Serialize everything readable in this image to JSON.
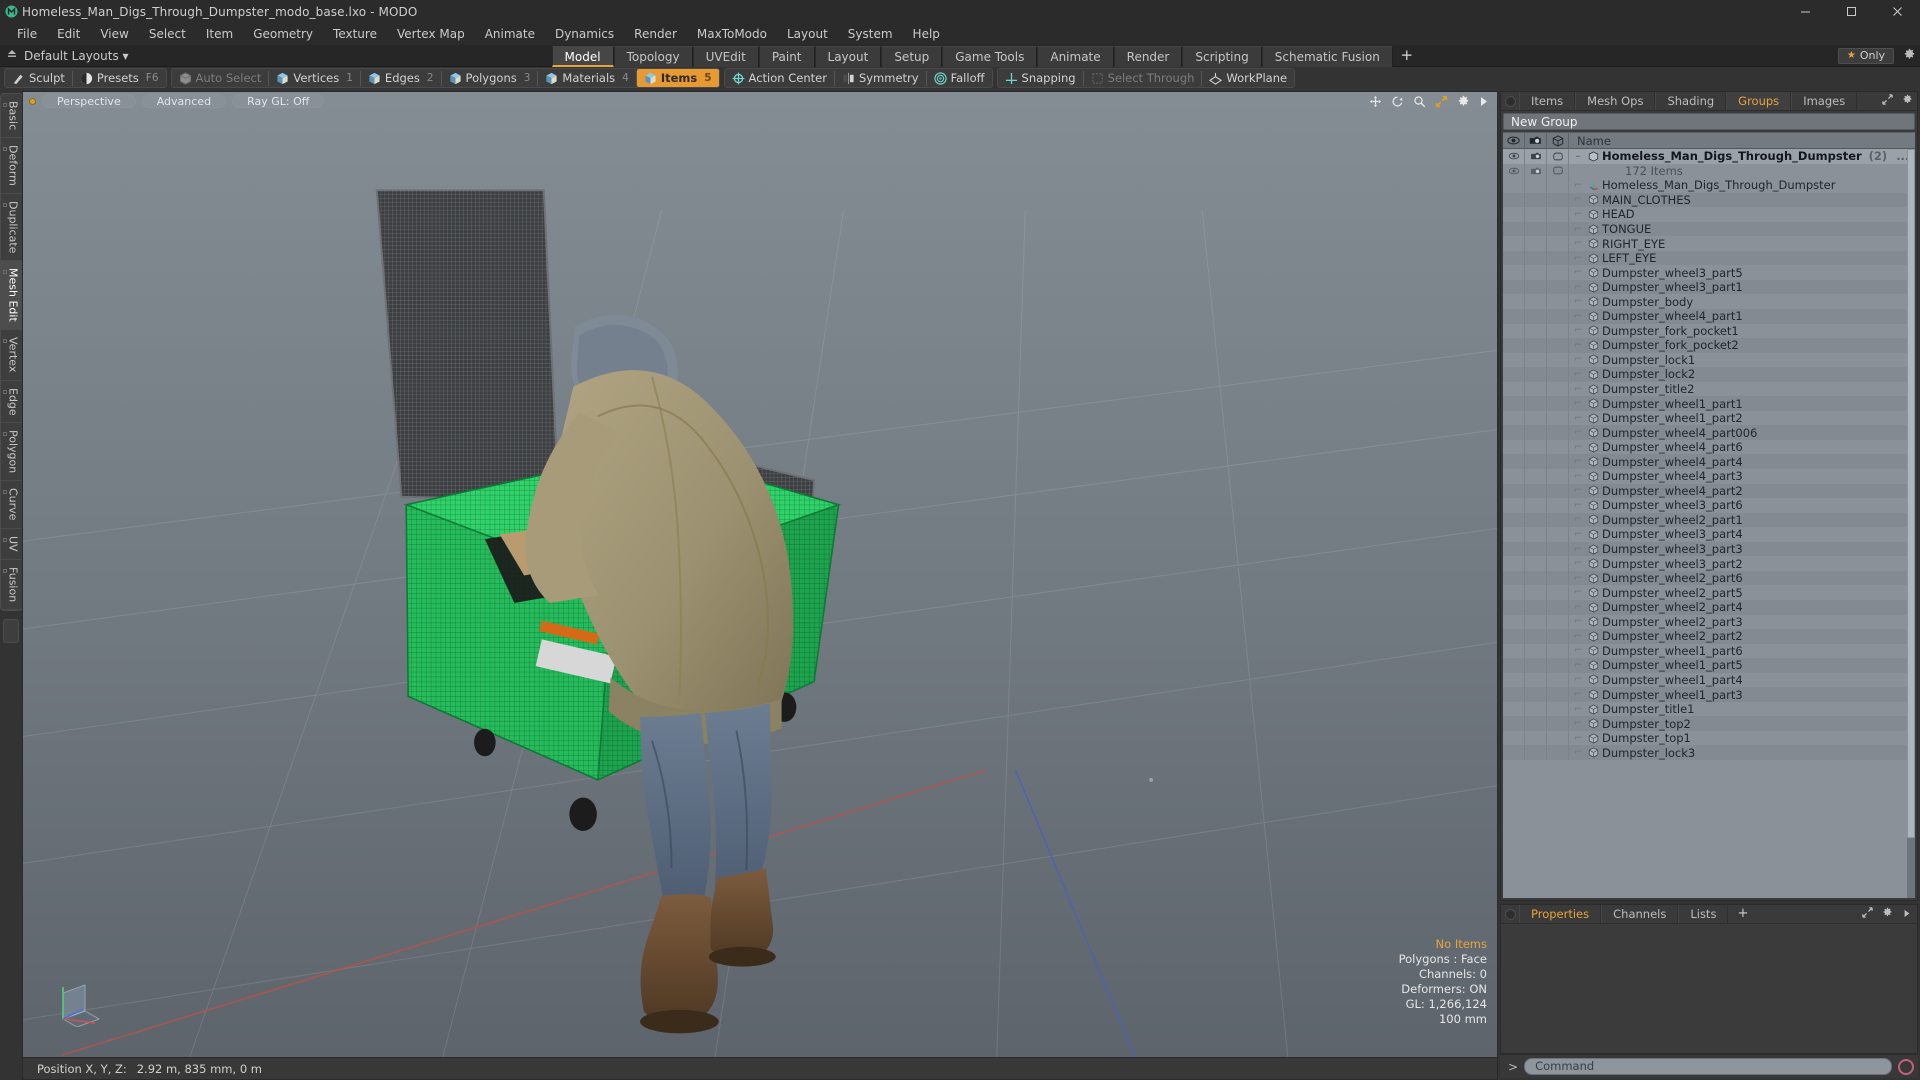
{
  "window": {
    "title": "Homeless_Man_Digs_Through_Dumpster_modo_base.lxo - MODO",
    "app_icon": "modo-logo-icon",
    "minimize": "–",
    "maximize": "□",
    "close": "✕"
  },
  "menubar": {
    "items": [
      "File",
      "Edit",
      "View",
      "Select",
      "Item",
      "Geometry",
      "Texture",
      "Vertex Map",
      "Animate",
      "Dynamics",
      "Render",
      "MaxToModo",
      "Layout",
      "System",
      "Help"
    ]
  },
  "layoutbar": {
    "home_icon": "home-arrow-icon",
    "default_layouts": "Default Layouts ▾",
    "tabs": [
      {
        "label": "Model",
        "active": true
      },
      {
        "label": "Topology",
        "active": false
      },
      {
        "label": "UVEdit",
        "active": false
      },
      {
        "label": "Paint",
        "active": false
      },
      {
        "label": "Layout",
        "active": false
      },
      {
        "label": "Setup",
        "active": false
      },
      {
        "label": "Game Tools",
        "active": false
      },
      {
        "label": "Animate",
        "active": false
      },
      {
        "label": "Render",
        "active": false
      },
      {
        "label": "Scripting",
        "active": false
      },
      {
        "label": "Schematic Fusion",
        "active": false
      }
    ],
    "add_tab": "+",
    "only_label": "Only",
    "only_star": "★",
    "gear": "gear-icon"
  },
  "modebar": {
    "group1": [
      {
        "label": "Sculpt",
        "icon": "sculpt-icon",
        "shortcut": "",
        "selected": false,
        "dim": false
      },
      {
        "label": "Presets",
        "icon": "presets-icon",
        "shortcut": "F6",
        "selected": false,
        "dim": false
      }
    ],
    "group2": [
      {
        "label": "Auto Select",
        "icon": "cube-grey-icon",
        "shortcut": "",
        "selected": false,
        "dim": true
      },
      {
        "label": "Vertices",
        "icon": "cube-blue-icon",
        "shortcut": "1",
        "selected": false,
        "dim": false
      },
      {
        "label": "Edges",
        "icon": "cube-blue-icon",
        "shortcut": "2",
        "selected": false,
        "dim": false
      },
      {
        "label": "Polygons",
        "icon": "cube-blue-icon",
        "shortcut": "3",
        "selected": false,
        "dim": false
      },
      {
        "label": "Materials",
        "icon": "cube-blue-icon",
        "shortcut": "4",
        "selected": false,
        "dim": false
      },
      {
        "label": "Items",
        "icon": "cube-blue-icon",
        "shortcut": "5",
        "selected": true,
        "dim": false
      }
    ],
    "group3": [
      {
        "label": "Action Center",
        "icon": "action-center-icon",
        "selected": false,
        "dim": false
      },
      {
        "label": "Symmetry",
        "icon": "symmetry-icon",
        "selected": false,
        "dim": false
      },
      {
        "label": "Falloff",
        "icon": "falloff-icon",
        "selected": false,
        "dim": false
      }
    ],
    "group4": [
      {
        "label": "Snapping",
        "icon": "snapping-icon",
        "selected": false,
        "dim": false
      },
      {
        "label": "Select Through",
        "icon": "select-through-icon",
        "selected": false,
        "dim": true
      },
      {
        "label": "WorkPlane",
        "icon": "workplane-icon",
        "selected": false,
        "dim": false
      }
    ]
  },
  "leftrail": {
    "tabs": [
      "Basic",
      "Deform",
      "Duplicate",
      "Mesh Edit",
      "Vertex",
      "Edge",
      "Polygon",
      "Curve",
      "UV",
      "Fusion"
    ],
    "active": "Mesh Edit"
  },
  "viewport": {
    "pills": [
      "Perspective",
      "Advanced",
      "Ray GL: Off"
    ],
    "tool_icons": [
      "move-icon",
      "rotate-icon",
      "zoom-icon",
      "fit-icon",
      "gear-icon",
      "play-arrow-icon"
    ],
    "stats": [
      {
        "text": "No Items",
        "amber": true
      },
      {
        "text": "Polygons : Face",
        "amber": false
      },
      {
        "text": "Channels: 0",
        "amber": false
      },
      {
        "text": "Deformers: ON",
        "amber": false
      },
      {
        "text": "GL: 1,266,124",
        "amber": false
      },
      {
        "text": "100 mm",
        "amber": false
      }
    ],
    "gizmo": "axis-gizmo"
  },
  "statusbar": {
    "position_label": "Position X, Y, Z:",
    "position_value": "2.92 m, 835 mm, 0 m"
  },
  "right_panel": {
    "tabs": [
      {
        "label": "Items",
        "active": false
      },
      {
        "label": "Mesh Ops",
        "active": false
      },
      {
        "label": "Shading",
        "active": false
      },
      {
        "label": "Groups",
        "active": true
      },
      {
        "label": "Images",
        "active": false
      }
    ],
    "new_group": "New Group",
    "list_header": {
      "col_eye": "eye-icon",
      "col_render": "render-icon",
      "col_shape": "cube-outline-icon",
      "name": "Name"
    },
    "group_row": {
      "name": "Homeless_Man_Digs_Through_Dumpster",
      "count": "(2)",
      "ellipsis": "...",
      "icon": "cube-outline-icon"
    },
    "sub_count": "172 Items",
    "items": [
      {
        "name": "Homeless_Man_Digs_Through_Dumpster",
        "icon": "locator-icon"
      },
      {
        "name": "MAIN_CLOTHES",
        "icon": "mesh-icon"
      },
      {
        "name": "HEAD",
        "icon": "mesh-icon"
      },
      {
        "name": "TONGUE",
        "icon": "mesh-icon"
      },
      {
        "name": "RIGHT_EYE",
        "icon": "mesh-icon"
      },
      {
        "name": "LEFT_EYE",
        "icon": "mesh-icon"
      },
      {
        "name": "Dumpster_wheel3_part5",
        "icon": "mesh-icon"
      },
      {
        "name": "Dumpster_wheel3_part1",
        "icon": "mesh-icon"
      },
      {
        "name": "Dumpster_body",
        "icon": "mesh-icon"
      },
      {
        "name": "Dumpster_wheel4_part1",
        "icon": "mesh-icon"
      },
      {
        "name": "Dumpster_fork_pocket1",
        "icon": "mesh-icon"
      },
      {
        "name": "Dumpster_fork_pocket2",
        "icon": "mesh-icon"
      },
      {
        "name": "Dumpster_lock1",
        "icon": "mesh-icon"
      },
      {
        "name": "Dumpster_lock2",
        "icon": "mesh-icon"
      },
      {
        "name": "Dumpster_title2",
        "icon": "mesh-icon"
      },
      {
        "name": "Dumpster_wheel1_part1",
        "icon": "mesh-icon"
      },
      {
        "name": "Dumpster_wheel1_part2",
        "icon": "mesh-icon"
      },
      {
        "name": "Dumpster_wheel4_part006",
        "icon": "mesh-icon"
      },
      {
        "name": "Dumpster_wheel4_part6",
        "icon": "mesh-icon"
      },
      {
        "name": "Dumpster_wheel4_part4",
        "icon": "mesh-icon"
      },
      {
        "name": "Dumpster_wheel4_part3",
        "icon": "mesh-icon"
      },
      {
        "name": "Dumpster_wheel4_part2",
        "icon": "mesh-icon"
      },
      {
        "name": "Dumpster_wheel3_part6",
        "icon": "mesh-icon"
      },
      {
        "name": "Dumpster_wheel2_part1",
        "icon": "mesh-icon"
      },
      {
        "name": "Dumpster_wheel3_part4",
        "icon": "mesh-icon"
      },
      {
        "name": "Dumpster_wheel3_part3",
        "icon": "mesh-icon"
      },
      {
        "name": "Dumpster_wheel3_part2",
        "icon": "mesh-icon"
      },
      {
        "name": "Dumpster_wheel2_part6",
        "icon": "mesh-icon"
      },
      {
        "name": "Dumpster_wheel2_part5",
        "icon": "mesh-icon"
      },
      {
        "name": "Dumpster_wheel2_part4",
        "icon": "mesh-icon"
      },
      {
        "name": "Dumpster_wheel2_part3",
        "icon": "mesh-icon"
      },
      {
        "name": "Dumpster_wheel2_part2",
        "icon": "mesh-icon"
      },
      {
        "name": "Dumpster_wheel1_part6",
        "icon": "mesh-icon"
      },
      {
        "name": "Dumpster_wheel1_part5",
        "icon": "mesh-icon"
      },
      {
        "name": "Dumpster_wheel1_part4",
        "icon": "mesh-icon"
      },
      {
        "name": "Dumpster_wheel1_part3",
        "icon": "mesh-icon"
      },
      {
        "name": "Dumpster_title1",
        "icon": "mesh-icon"
      },
      {
        "name": "Dumpster_top2",
        "icon": "mesh-icon"
      },
      {
        "name": "Dumpster_top1",
        "icon": "mesh-icon"
      },
      {
        "name": "Dumpster_lock3",
        "icon": "mesh-icon"
      }
    ]
  },
  "properties_panel": {
    "tabs": [
      {
        "label": "Properties",
        "active": true
      },
      {
        "label": "Channels",
        "active": false
      },
      {
        "label": "Lists",
        "active": false
      }
    ],
    "add_tab": "+",
    "resize_icon": "resize-icon",
    "gear_icon": "gear-icon",
    "arrow_icon": "play-arrow-icon"
  },
  "command_bar": {
    "prompt": ">",
    "placeholder": "Command",
    "record_icon": "record-circle-icon"
  },
  "colors": {
    "accent": "#e8a33d",
    "selection_green": "#2fd36a",
    "panel_bg": "#3b3b3b",
    "list_bg": "#8a9199"
  }
}
